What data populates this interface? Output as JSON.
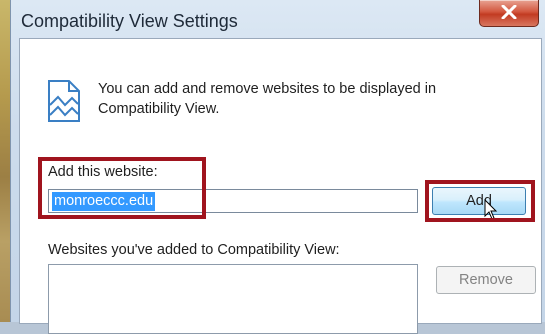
{
  "window": {
    "title": "Compatibility View Settings",
    "close_icon": "close-x-icon"
  },
  "info": {
    "icon": "compatibility-view-icon",
    "text": "You can add and remove websites to be displayed in Compatibility View."
  },
  "add_site": {
    "label": "Add this website:",
    "value": "monroeccc.edu",
    "add_button": "Add"
  },
  "site_list": {
    "label": "Websites you've added to Compatibility View:",
    "items": [],
    "remove_button": "Remove"
  },
  "colors": {
    "highlight": "#a0141e",
    "selection": "#3399ff",
    "close_button": "#c23b22"
  }
}
